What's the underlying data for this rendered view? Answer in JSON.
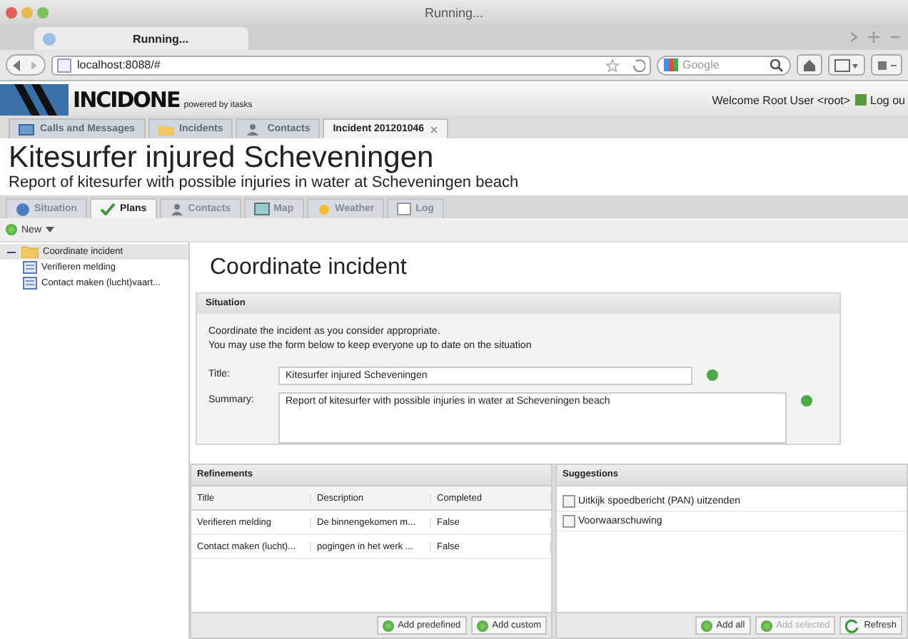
{
  "browser": {
    "window_title": "Running...",
    "tab_title": "Running...",
    "url": "localhost:8088/#",
    "search_placeholder": "Google"
  },
  "header": {
    "logo": "INCIDONE",
    "tagline": "powered by itasks",
    "welcome": "Welcome Root User <root>",
    "logout": "Log ou"
  },
  "main_tabs": [
    {
      "label": "Calls and Messages",
      "selected": false,
      "kind": "mail"
    },
    {
      "label": "Incidents",
      "selected": false,
      "kind": "folder"
    },
    {
      "label": "Contacts",
      "selected": false,
      "kind": "person"
    },
    {
      "label": "Incident 201201046",
      "selected": true,
      "kind": "plain"
    }
  ],
  "incident": {
    "title": "Kitesurfer injured Scheveningen",
    "subtitle": "Report of kitesurfer with possible injuries in water at Scheveningen beach"
  },
  "sub_tabs": [
    {
      "label": "Situation",
      "selected": false,
      "kind": "info"
    },
    {
      "label": "Plans",
      "selected": true,
      "kind": "check"
    },
    {
      "label": "Contacts",
      "selected": false,
      "kind": "person"
    },
    {
      "label": "Map",
      "selected": false,
      "kind": "map"
    },
    {
      "label": "Weather",
      "selected": false,
      "kind": "sun"
    },
    {
      "label": "Log",
      "selected": false,
      "kind": "log"
    }
  ],
  "new_button": "New",
  "tree": [
    {
      "label": "Coordinate incident",
      "expanded": true,
      "selected": true,
      "children": [
        {
          "label": "Verifieren melding"
        },
        {
          "label": "Contact maken (lucht)vaart..."
        }
      ]
    }
  ],
  "task": {
    "heading": "Coordinate incident",
    "panel_title": "Situation",
    "intro": [
      "Coordinate the incident as you consider appropriate.",
      "You may use the form below to keep everyone up to date on the situation"
    ],
    "fields": [
      {
        "label": "Title:",
        "value": "Kitesurfer injured Scheveningen",
        "kind": "line"
      },
      {
        "label": "Summary:",
        "value": "Report of kitesurfer with possible injuries in water at Scheveningen beach",
        "kind": "area"
      }
    ]
  },
  "refinements": {
    "title": "Refinements",
    "columns": [
      "Title",
      "Description",
      "Completed"
    ],
    "rows": [
      [
        "Verifieren melding",
        "De binnengekomen m...",
        "False"
      ],
      [
        "Contact maken (lucht)...",
        "pogingen in het werk ...",
        "False"
      ]
    ],
    "buttons": [
      {
        "label": "Add predefined",
        "disabled": false
      },
      {
        "label": "Add custom",
        "disabled": false
      }
    ]
  },
  "suggestions": {
    "title": "Suggestions",
    "items": [
      {
        "label": "Uitkijk spoedbericht (PAN) uitzenden",
        "checked": false
      },
      {
        "label": "Voorwaarschuwing",
        "checked": false
      }
    ],
    "buttons": [
      {
        "label": "Add all",
        "disabled": false,
        "kind": "add"
      },
      {
        "label": "Add selected",
        "disabled": true,
        "kind": "add"
      },
      {
        "label": "Refresh",
        "disabled": false,
        "kind": "refresh"
      }
    ]
  }
}
